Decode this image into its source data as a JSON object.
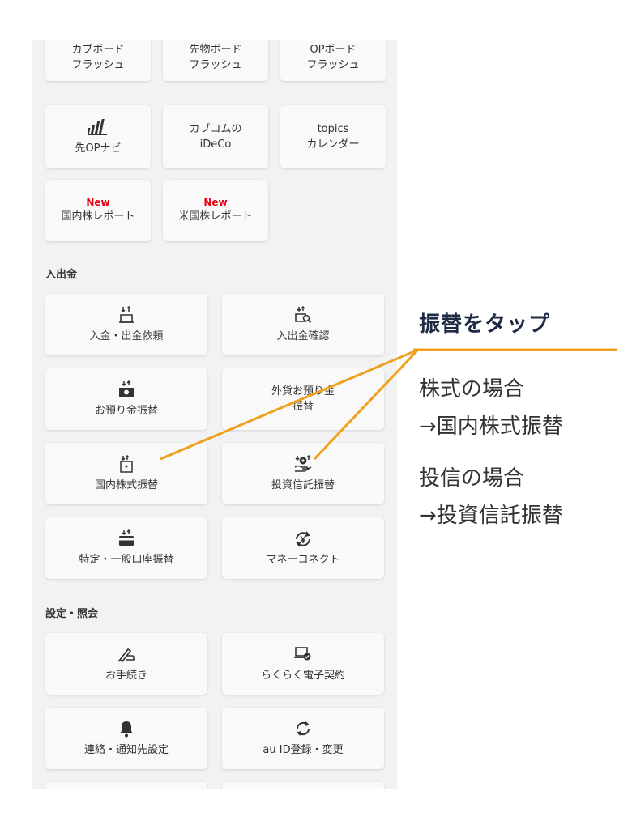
{
  "top_grid": [
    {
      "id": "kabu-board",
      "label": "カブボード\nフラッシュ"
    },
    {
      "id": "futures-board",
      "label": "先物ボード\nフラッシュ"
    },
    {
      "id": "op-board",
      "label": "OPボード\nフラッシュ"
    },
    {
      "id": "op-navi",
      "label": "先OPナビ",
      "icon": "chart-bars-icon"
    },
    {
      "id": "ideco",
      "label": "カブコムの\niDeCo"
    },
    {
      "id": "topics-calendar",
      "label": "topics\nカレンダー"
    },
    {
      "id": "jp-report",
      "new": "New",
      "label": "国内株レポート"
    },
    {
      "id": "us-report",
      "new": "New",
      "label": "米国株レポート"
    }
  ],
  "deposit_section": {
    "title": "入出金",
    "items": [
      {
        "id": "deposit-request",
        "label": "入金・出金依頼",
        "icon": "deposit-arrows-icon"
      },
      {
        "id": "deposit-confirm",
        "label": "入出金確認",
        "icon": "deposit-search-icon"
      },
      {
        "id": "deposit-transfer",
        "label": "お預り金振替",
        "icon": "cash-transfer-icon"
      },
      {
        "id": "fx-transfer",
        "label": "外貨お預り金\n振替"
      },
      {
        "id": "jp-stock-transfer",
        "label": "国内株式振替",
        "icon": "stock-transfer-icon"
      },
      {
        "id": "fund-transfer",
        "label": "投資信託振替",
        "icon": "money-bag-hand-icon"
      },
      {
        "id": "account-transfer",
        "label": "特定・一般口座振替",
        "icon": "card-transfer-icon"
      },
      {
        "id": "money-connect",
        "label": "マネーコネクト",
        "icon": "yen-cycle-icon"
      }
    ]
  },
  "settings_section": {
    "title": "設定・照会",
    "items": [
      {
        "id": "procedures",
        "label": "お手続き",
        "icon": "hand-pen-icon"
      },
      {
        "id": "e-contract",
        "label": "らくらく電子契約",
        "icon": "laptop-check-icon"
      },
      {
        "id": "contact-settings",
        "label": "連絡・通知先設定",
        "icon": "bell-icon"
      },
      {
        "id": "auid",
        "label": "au ID登録・変更",
        "icon": "refresh-icon"
      }
    ]
  },
  "annotation": {
    "title": "振替をタップ",
    "stock_case": "株式の場合",
    "stock_target": "→国内株式振替",
    "fund_case": "投信の場合",
    "fund_target": "→投資信託振替",
    "line_color": "#f0a020"
  }
}
